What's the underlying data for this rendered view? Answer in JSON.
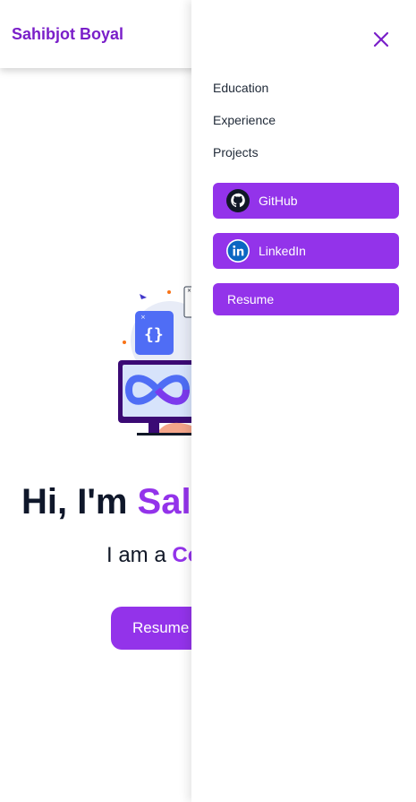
{
  "header": {
    "brand": "Sahibjot Boyal"
  },
  "hero": {
    "greeting": "Hi, I'm ",
    "name_visible": "Sal",
    "subtitle_prefix": "I am a ",
    "subtitle_role_visible": "Co",
    "resume_label": "Resume",
    "illustration_icon": "devops-infinity-monitor-icon"
  },
  "drawer": {
    "close_icon": "close-icon",
    "nav": [
      {
        "label": "Education"
      },
      {
        "label": "Experience"
      },
      {
        "label": "Projects"
      }
    ],
    "buttons": [
      {
        "label": "GitHub",
        "icon": "github-icon"
      },
      {
        "label": "LinkedIn",
        "icon": "linkedin-icon"
      },
      {
        "label": "Resume"
      }
    ]
  },
  "colors": {
    "brand": "#7a1fc9",
    "accent": "#9333ea",
    "heading": "#0f172a"
  }
}
